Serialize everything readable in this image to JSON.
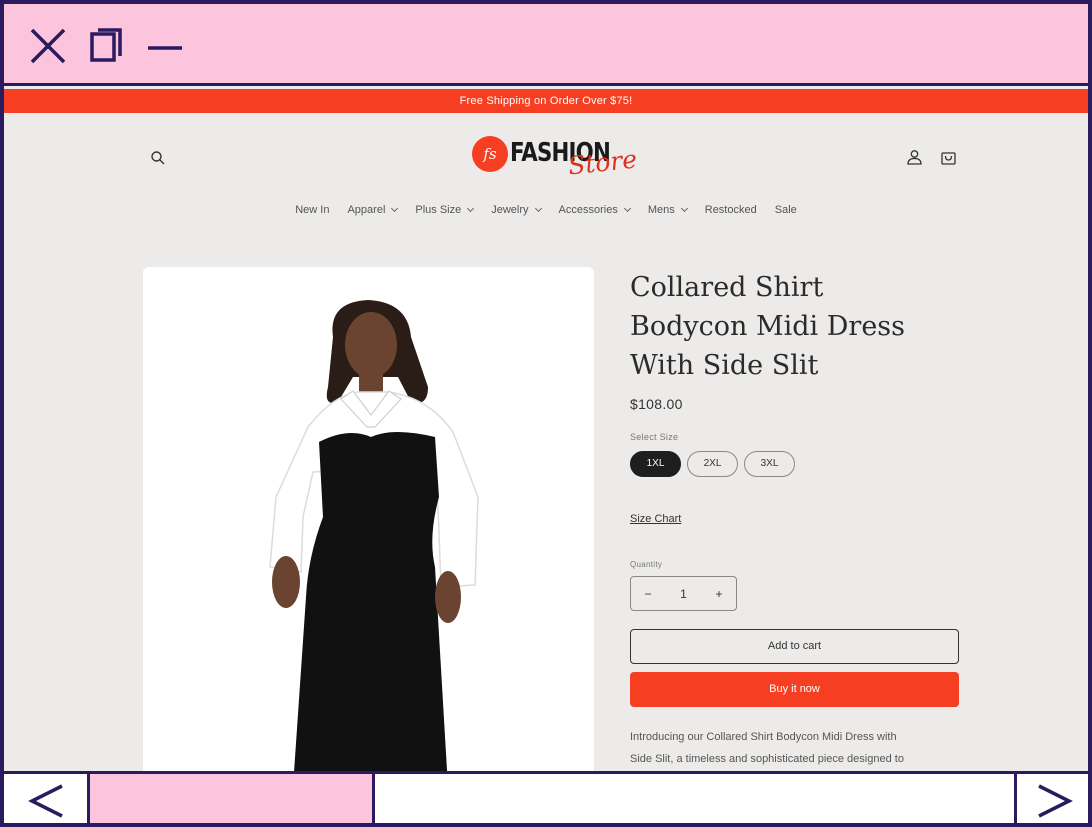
{
  "window": {
    "close_icon": "close-icon",
    "maximize_icon": "maximize-icon",
    "minimize_icon": "minimize-icon"
  },
  "promo": {
    "text": "Free Shipping on Order Over $75!"
  },
  "header": {
    "logo_monogram": "fs",
    "logo_main": "FASHION",
    "logo_script": "Store"
  },
  "nav": {
    "items": [
      {
        "label": "New In",
        "dropdown": false
      },
      {
        "label": "Apparel",
        "dropdown": true
      },
      {
        "label": "Plus Size",
        "dropdown": true
      },
      {
        "label": "Jewelry",
        "dropdown": true
      },
      {
        "label": "Accessories",
        "dropdown": true
      },
      {
        "label": "Mens",
        "dropdown": true
      },
      {
        "label": "Restocked",
        "dropdown": false
      },
      {
        "label": "Sale",
        "dropdown": false
      }
    ]
  },
  "product": {
    "title_lines": [
      "Collared Shirt",
      "Bodycon Midi Dress",
      "With Side Slit"
    ],
    "price": "$108.00",
    "size_label": "Select Size",
    "sizes": [
      {
        "label": "1XL",
        "selected": true
      },
      {
        "label": "2XL",
        "selected": false
      },
      {
        "label": "3XL",
        "selected": false
      }
    ],
    "size_chart": "Size Chart",
    "quantity_label": "Quantity",
    "quantity_value": "1",
    "qty_minus": "−",
    "qty_plus": "+",
    "add_to_cart": "Add to cart",
    "buy_now": "Buy it now",
    "description_lines": [
      "Introducing our Collared Shirt Bodycon Midi Dress with",
      "Side Slit, a timeless and sophisticated piece designed to"
    ]
  },
  "colors": {
    "brand_accent": "#f63f22",
    "window_chrome": "#fcc4dd",
    "frame_border": "#2a1a5e",
    "page_bg": "#ecebea"
  }
}
